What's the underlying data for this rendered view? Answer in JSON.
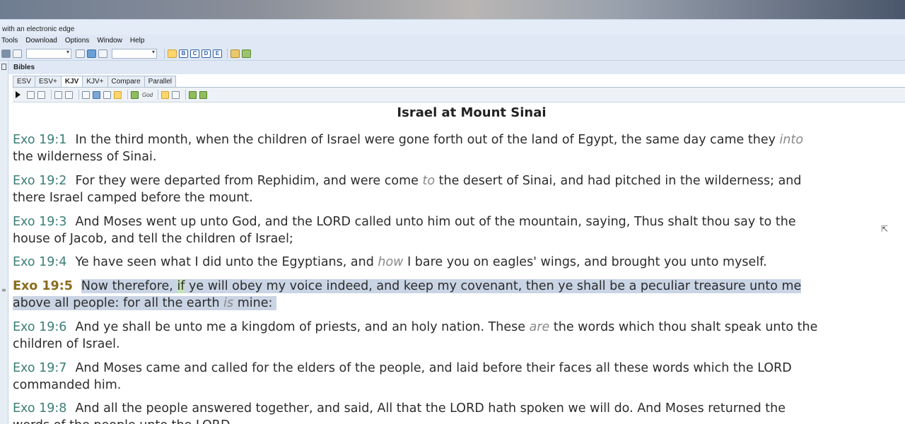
{
  "window": {
    "title": "with an electronic edge"
  },
  "menu": [
    "Tools",
    "Download",
    "Options",
    "Window",
    "Help"
  ],
  "panel": {
    "title": "Bibles"
  },
  "tabs": [
    {
      "label": "ESV",
      "active": false
    },
    {
      "label": "ESV+",
      "active": false
    },
    {
      "label": "KJV",
      "active": true
    },
    {
      "label": "KJV+",
      "active": false
    },
    {
      "label": "Compare",
      "active": false
    },
    {
      "label": "Parallel",
      "active": false
    }
  ],
  "subtoolbar": {
    "god_label": "God"
  },
  "passage": {
    "heading": "Israel at Mount Sinai",
    "verses": [
      {
        "ref": "Exo 19:1",
        "line1": "In the third month, when the children of Israel were gone forth out of the land of Egypt, the same day came they ",
        "line1_italic": "into",
        "line2": "the wilderness of Sinai."
      },
      {
        "ref": "Exo 19:2",
        "line1a": "For they were departed from Rephidim, and were come ",
        "line1_italic": "to",
        "line1b": " the desert of Sinai, and had pitched in the wilderness; and",
        "line2": "there Israel camped before the mount."
      },
      {
        "ref": "Exo 19:3",
        "line1": "And Moses went up unto God, and the LORD called unto him out of the mountain, saying, Thus shalt thou say to the",
        "line2": "house of Jacob, and tell the children of Israel;"
      },
      {
        "ref": "Exo 19:4",
        "line1a": "Ye have seen what I did unto the Egyptians, and ",
        "line1_italic": "how",
        "line1b": " I bare you on eagles' wings, and brought you unto myself."
      },
      {
        "ref": "Exo 19:5",
        "line1a": "Now therefore, ",
        "line1_word": "if",
        "line1b": " ye will obey my voice indeed, and keep my covenant, then ye shall be a peculiar treasure unto me",
        "line2a": "above all people: for all the earth ",
        "line2_italic": "is",
        "line2b": " mine:"
      },
      {
        "ref": "Exo 19:6",
        "line1a": "And ye shall be unto me a kingdom of priests, and an holy nation. These ",
        "line1_italic": "are",
        "line1b": " the words which thou shalt speak unto the",
        "line2": "children of Israel."
      },
      {
        "ref": "Exo 19:7",
        "line1": "And Moses came and called for the elders of the people, and laid before their faces all these words which the LORD",
        "line2": "commanded him."
      },
      {
        "ref": "Exo 19:8",
        "line1": "And all the people answered together, and said, All that the LORD hath spoken we will do. And Moses returned the",
        "line2": "words of the people unto the LORD."
      }
    ]
  },
  "colors": {
    "reference": "#3c7f78",
    "selected_reference": "#8a6d1e",
    "selection": "#c9d4e4",
    "search_hit": "#c6e2b8"
  }
}
